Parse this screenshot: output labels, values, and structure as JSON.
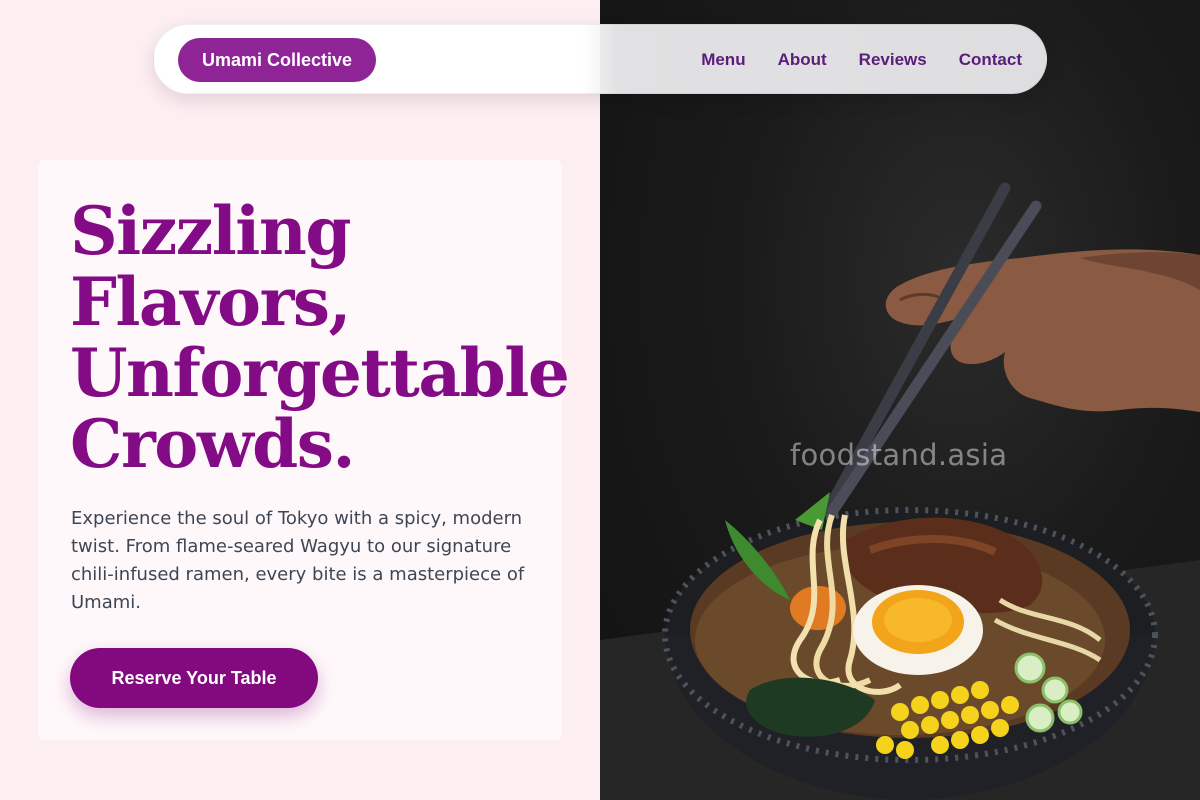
{
  "brand": {
    "name": "Umami Collective"
  },
  "nav": {
    "links": [
      {
        "label": "Menu"
      },
      {
        "label": "About"
      },
      {
        "label": "Reviews"
      },
      {
        "label": "Contact"
      }
    ]
  },
  "hero": {
    "headline_lines": [
      "Sizzling",
      "Flavors,",
      "Unforgettable",
      "Crowds."
    ],
    "description": "Experience the soul of Tokyo with a spicy, modern twist. From flame-seared Wagyu to our signature chili-infused ramen, every bite is a masterpiece of Umami.",
    "cta_label": "Reserve Your Table",
    "image_watermark": "foodstand.asia"
  },
  "colors": {
    "brand_purple": "#8e2496",
    "headline_purple": "#840b86",
    "nav_text": "#5b1d7a",
    "page_bg": "#fdeef2",
    "card_bg": "#fff8fa"
  },
  "icons": {
    "hero_photo": "ramen-bowl-with-chopsticks-photo"
  }
}
